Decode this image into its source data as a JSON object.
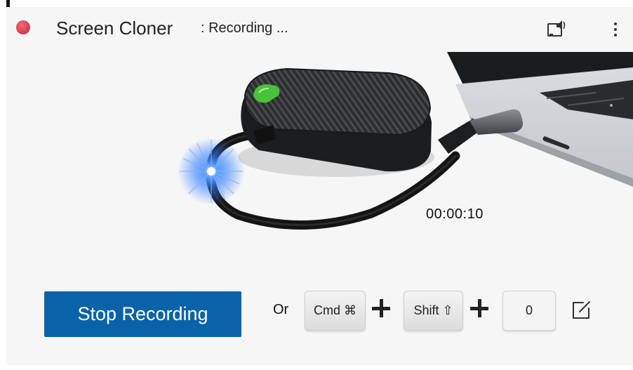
{
  "titlebar": {
    "app_title": "Screen Cloner",
    "status": ": Recording ...",
    "record_indicator_color": "#d93b50"
  },
  "hero": {
    "image": "usb-screen-cloner-device-plugged-into-laptop",
    "led_color": "#2f7bff"
  },
  "timer": "00:00:10",
  "actions": {
    "stop_label": "Stop Recording",
    "stop_color": "#0a63a8",
    "or_label": "Or",
    "shortcut": {
      "key1": "Cmd ⌘",
      "key2": "Shift ⇧",
      "key3": "0"
    }
  },
  "icons": {
    "cast": "cast-audio-icon",
    "more": "more-vertical-icon",
    "edit": "edit-icon"
  }
}
